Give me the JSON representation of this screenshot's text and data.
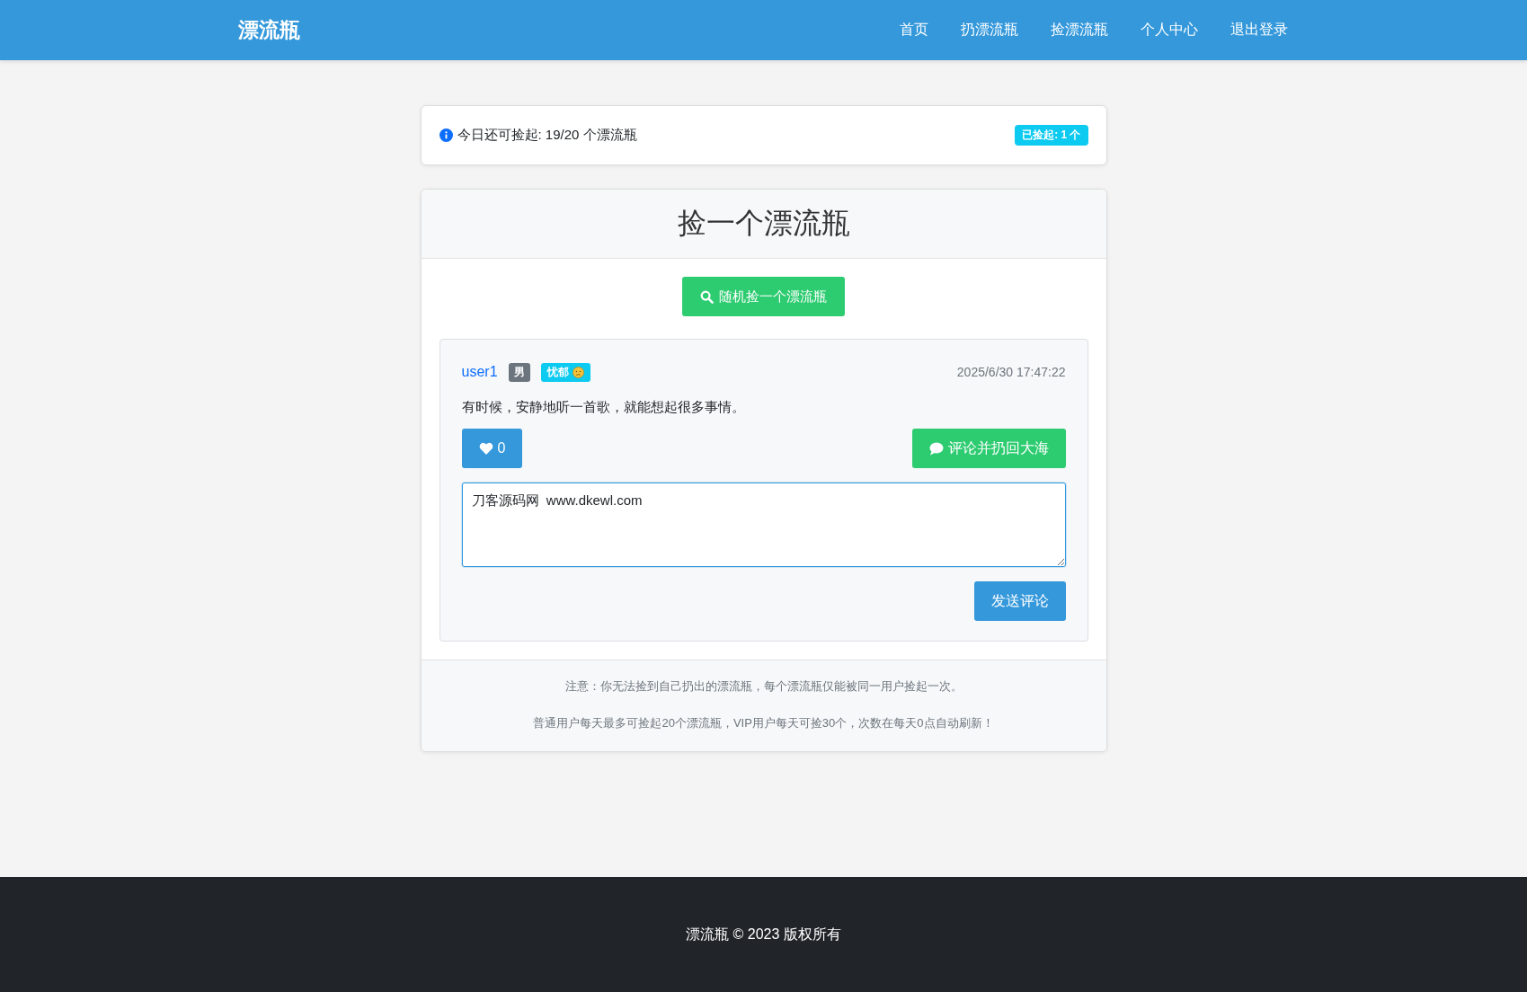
{
  "navbar": {
    "brand": "漂流瓶",
    "links": [
      {
        "label": "首页"
      },
      {
        "label": "扔漂流瓶"
      },
      {
        "label": "捡漂流瓶"
      },
      {
        "label": "个人中心"
      },
      {
        "label": "退出登录"
      }
    ]
  },
  "quota": {
    "text": "今日还可捡起: 19/20 个漂流瓶",
    "badge": "已捡起: 1 个"
  },
  "pick": {
    "title": "捡一个漂流瓶",
    "button": "随机捡一个漂流瓶",
    "bottle": {
      "username": "user1",
      "gender": "男",
      "mood": "忧郁",
      "time": "2025/6/30 17:47:22",
      "content": "有时候，安静地听一首歌，就能想起很多事情。",
      "likes": "0",
      "comment_button": "评论并扔回大海",
      "comment": {
        "value": "刀客源码网  www.dkewl.com"
      },
      "send_button": "发送评论"
    },
    "notes": [
      "注意：你无法捡到自己扔出的漂流瓶，每个漂流瓶仅能被同一用户捡起一次。",
      "普通用户每天最多可捡起20个漂流瓶，VIP用户每天可捡30个，次数在每天0点自动刷新！"
    ]
  },
  "footer": {
    "text": "漂流瓶 © 2023 版权所有"
  }
}
